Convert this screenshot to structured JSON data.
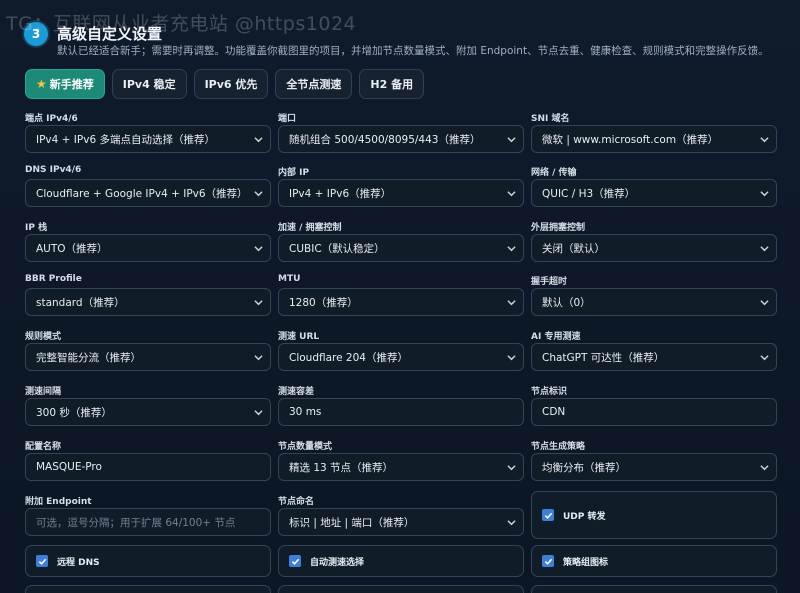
{
  "watermark": "TG：互联网从业者充电站 @https1024",
  "header": {
    "step": "3",
    "title": "高级自定义设置",
    "subtitle": "默认已经适合新手；需要时再调整。功能覆盖你截图里的项目，并增加节点数量模式、附加 Endpoint、节点去重、健康检查、规则模式和完整操作反馈。"
  },
  "presets": [
    {
      "label": "新手推荐",
      "active": true,
      "icon": "star-icon"
    },
    {
      "label": "IPv4 稳定",
      "active": false
    },
    {
      "label": "IPv6 优先",
      "active": false
    },
    {
      "label": "全节点测速",
      "active": false
    },
    {
      "label": "H2 备用",
      "active": false
    }
  ],
  "fields": {
    "endpoint_ipver": {
      "label": "端点 IPv4/6",
      "value": "IPv4 + IPv6 多端点自动选择（推荐）"
    },
    "port": {
      "label": "端口",
      "value": "随机组合 500/4500/8095/443（推荐）"
    },
    "sni": {
      "label": "SNI 域名",
      "value": "微软 | www.microsoft.com（推荐）"
    },
    "dns": {
      "label": "DNS IPv4/6",
      "value": "Cloudflare + Google IPv4 + IPv6（推荐）"
    },
    "internal_ip": {
      "label": "内部 IP",
      "value": "IPv4 + IPv6（推荐）"
    },
    "network": {
      "label": "网络 / 传输",
      "value": "QUIC / H3（推荐）"
    },
    "ip_stack": {
      "label": "IP 栈",
      "value": "AUTO（推荐）"
    },
    "congestion": {
      "label": "加速 / 拥塞控制",
      "value": "CUBIC（默认稳定）"
    },
    "outer_congestion": {
      "label": "外层拥塞控制",
      "value": "关闭（默认）"
    },
    "bbr": {
      "label": "BBR Profile",
      "value": "standard（推荐）"
    },
    "mtu": {
      "label": "MTU",
      "value": "1280（推荐）"
    },
    "handshake": {
      "label": "握手超时",
      "value": "默认（0）"
    },
    "rule_mode": {
      "label": "规则模式",
      "value": "完整智能分流（推荐）"
    },
    "speedtest_url": {
      "label": "测速 URL",
      "value": "Cloudflare 204（推荐）"
    },
    "ai_test": {
      "label": "AI 专用测速",
      "value": "ChatGPT 可达性（推荐）"
    },
    "interval": {
      "label": "测速间隔",
      "value": "300 秒（推荐）"
    },
    "tolerance": {
      "label": "测速容差",
      "value": "30 ms"
    },
    "node_tag": {
      "label": "节点标识",
      "value": "CDN"
    },
    "profile_name": {
      "label": "配置名称",
      "value": "MASQUE-Pro"
    },
    "node_count": {
      "label": "节点数量模式",
      "value": "精选 13 节点（推荐）"
    },
    "node_strategy": {
      "label": "节点生成策略",
      "value": "均衡分布（推荐）"
    },
    "extra_endpoint": {
      "label": "附加 Endpoint",
      "placeholder": "可选，逗号分隔；用于扩展 64/100+ 节点"
    },
    "node_naming": {
      "label": "节点命名",
      "value": "标识 | 地址 | 端口（推荐）"
    }
  },
  "checks": {
    "udp": {
      "label": "UDP 转发",
      "checked": true
    },
    "remote_dns": {
      "label": "远程 DNS",
      "checked": true
    },
    "auto_select": {
      "label": "自动测速选择",
      "checked": true
    },
    "group_icon": {
      "label": "策略组图标",
      "checked": true
    }
  },
  "colors": {
    "accent": "#1d8a78",
    "checkbox": "#3f7fd8",
    "badge": "#1e9ad6"
  }
}
